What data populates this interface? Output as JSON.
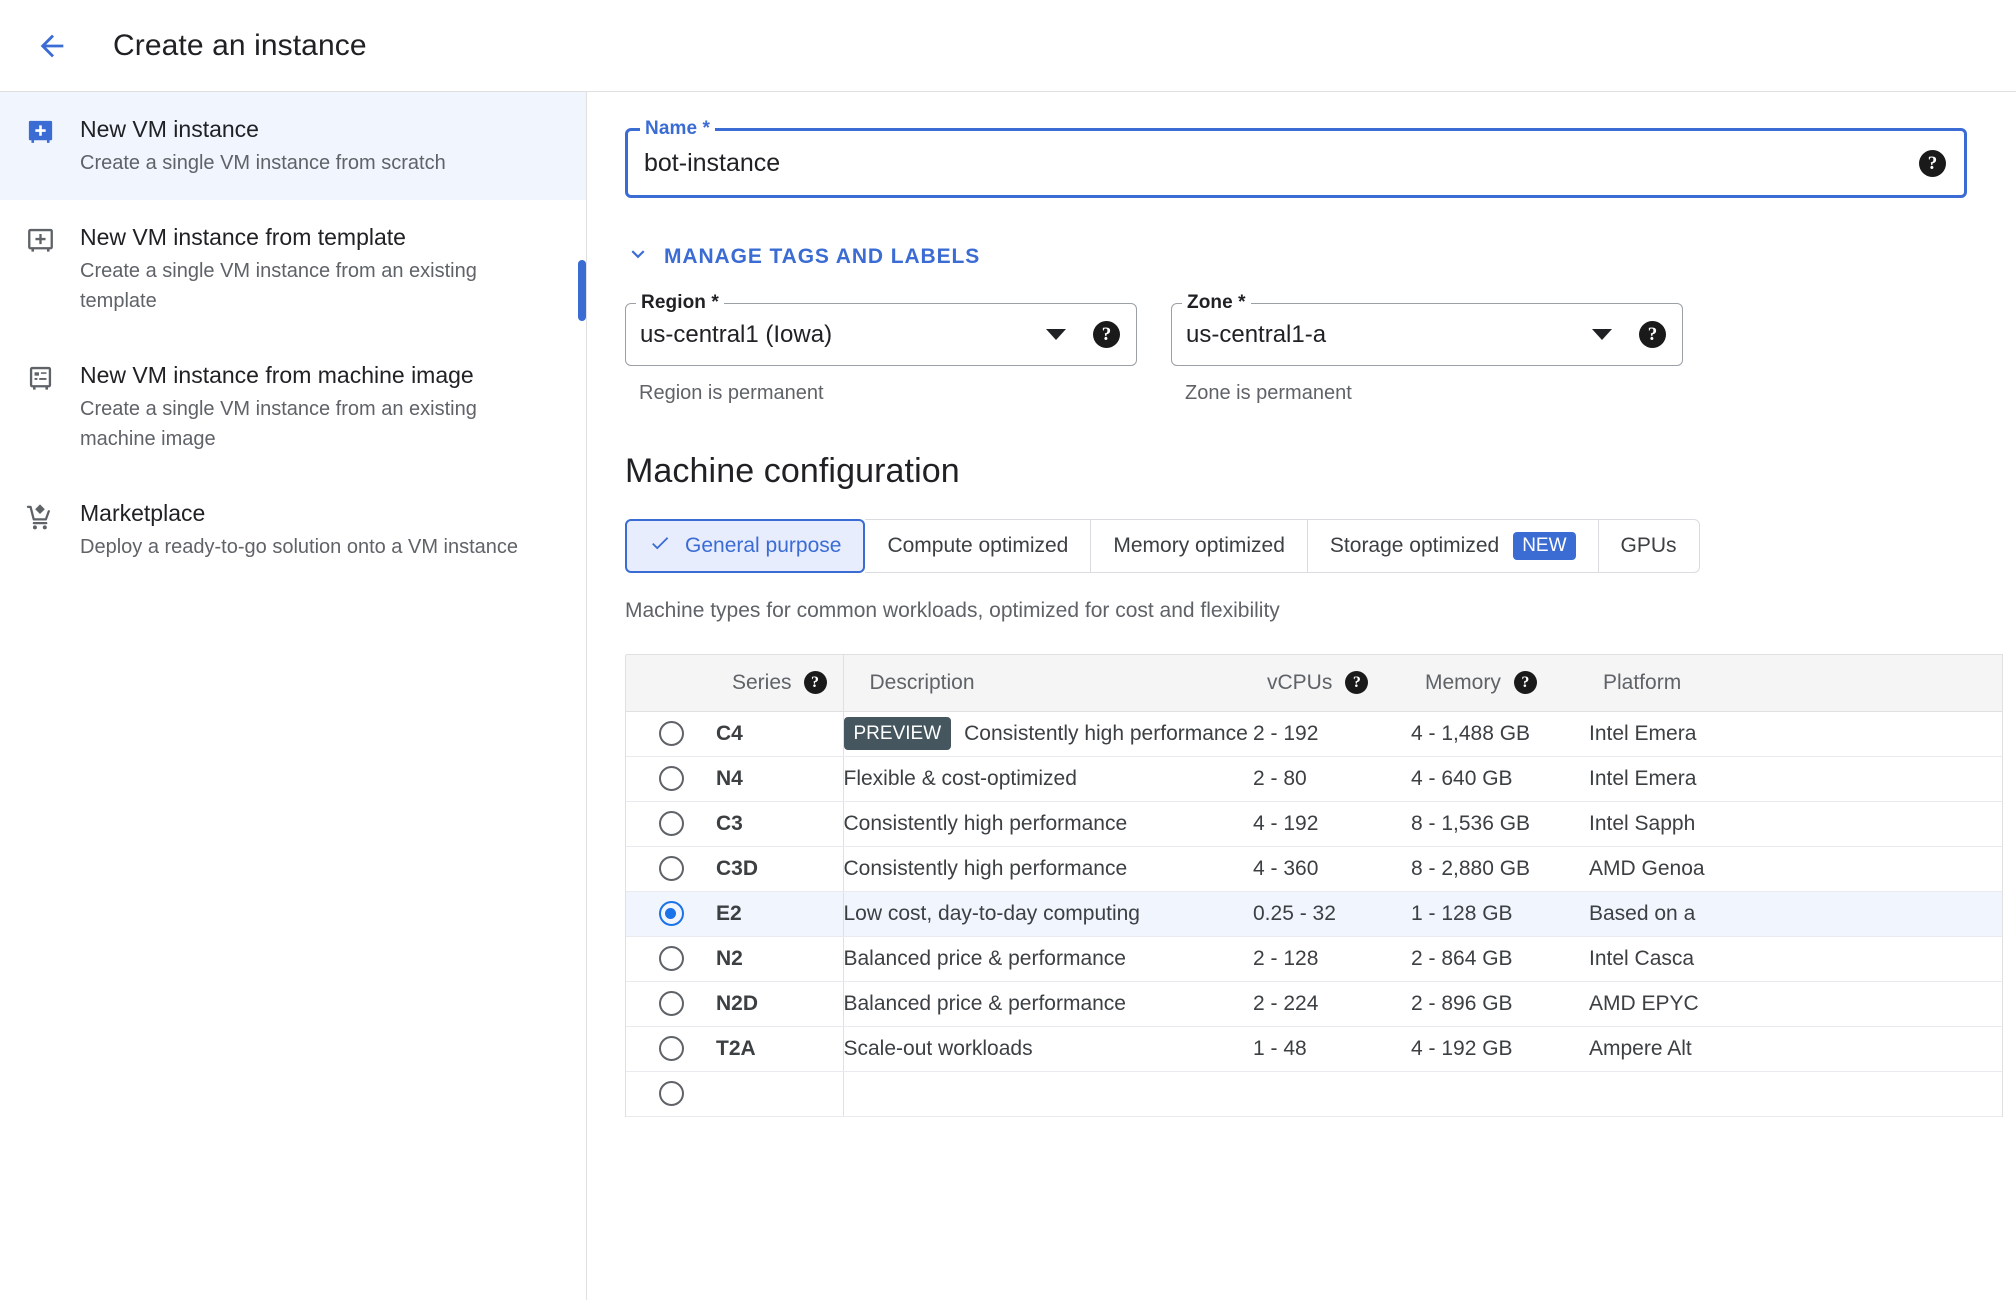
{
  "header": {
    "back_icon": "arrow-back-icon",
    "title": "Create an instance"
  },
  "sidebar": {
    "items": [
      {
        "icon": "vm-instance-add-filled-icon",
        "title": "New VM instance",
        "desc": "Create a single VM instance from scratch",
        "selected": true
      },
      {
        "icon": "vm-instance-template-icon",
        "title": "New VM instance from template",
        "desc": "Create a single VM instance from an existing template",
        "selected": false
      },
      {
        "icon": "machine-image-icon",
        "title": "New VM instance from machine image",
        "desc": "Create a single VM instance from an existing machine image",
        "selected": false
      },
      {
        "icon": "shopping-cart-icon",
        "title": "Marketplace",
        "desc": "Deploy a ready-to-go solution onto a VM instance",
        "selected": false
      }
    ]
  },
  "form": {
    "name_field": {
      "label": "Name *",
      "value": "bot-instance",
      "help_icon": "help-icon"
    },
    "manage_tags": {
      "label": "MANAGE TAGS AND LABELS",
      "chevron_icon": "chevron-down-icon"
    },
    "region": {
      "label": "Region *",
      "value": "us-central1 (Iowa)",
      "helper": "Region is permanent",
      "caret_icon": "dropdown-caret-icon",
      "help_icon": "help-icon"
    },
    "zone": {
      "label": "Zone *",
      "value": "us-central1-a",
      "helper": "Zone is permanent",
      "caret_icon": "dropdown-caret-icon",
      "help_icon": "help-icon"
    }
  },
  "machine_config": {
    "title": "Machine configuration",
    "tabs": [
      {
        "label": "General purpose",
        "active": true,
        "badge": "",
        "check_icon": "check-icon"
      },
      {
        "label": "Compute optimized",
        "active": false,
        "badge": ""
      },
      {
        "label": "Memory optimized",
        "active": false,
        "badge": ""
      },
      {
        "label": "Storage optimized",
        "active": false,
        "badge": "NEW"
      },
      {
        "label": "GPUs",
        "active": false,
        "badge": ""
      }
    ],
    "tab_description": "Machine types for common workloads, optimized for cost and flexibility",
    "table": {
      "columns": [
        "Series",
        "Description",
        "vCPUs",
        "Memory",
        "Platform"
      ],
      "rows": [
        {
          "selected": false,
          "series": "C4",
          "badge": "PREVIEW",
          "description": "Consistently high performance",
          "vcpus": "2 - 192",
          "memory": "4 - 1,488 GB",
          "platform": "Intel Emera"
        },
        {
          "selected": false,
          "series": "N4",
          "badge": "",
          "description": "Flexible & cost-optimized",
          "vcpus": "2 - 80",
          "memory": "4 - 640 GB",
          "platform": "Intel Emera"
        },
        {
          "selected": false,
          "series": "C3",
          "badge": "",
          "description": "Consistently high performance",
          "vcpus": "4 - 192",
          "memory": "8 - 1,536 GB",
          "platform": "Intel Sapph"
        },
        {
          "selected": false,
          "series": "C3D",
          "badge": "",
          "description": "Consistently high performance",
          "vcpus": "4 - 360",
          "memory": "8 - 2,880 GB",
          "platform": "AMD Genoa"
        },
        {
          "selected": true,
          "series": "E2",
          "badge": "",
          "description": "Low cost, day-to-day computing",
          "vcpus": "0.25 - 32",
          "memory": "1 - 128 GB",
          "platform": "Based on a"
        },
        {
          "selected": false,
          "series": "N2",
          "badge": "",
          "description": "Balanced price & performance",
          "vcpus": "2 - 128",
          "memory": "2 - 864 GB",
          "platform": "Intel Casca"
        },
        {
          "selected": false,
          "series": "N2D",
          "badge": "",
          "description": "Balanced price & performance",
          "vcpus": "2 - 224",
          "memory": "2 - 896 GB",
          "platform": "AMD EPYC"
        },
        {
          "selected": false,
          "series": "T2A",
          "badge": "",
          "description": "Scale-out workloads",
          "vcpus": "1 - 48",
          "memory": "4 - 192 GB",
          "platform": "Ampere Alt"
        }
      ]
    }
  },
  "colors": {
    "accent_blue": "#3b6cd4",
    "selected_row_bg": "#f1f5fe",
    "radio_on": "#1a73e8",
    "preview_badge": "#45565f",
    "new_badge": "#3b6cd4"
  }
}
